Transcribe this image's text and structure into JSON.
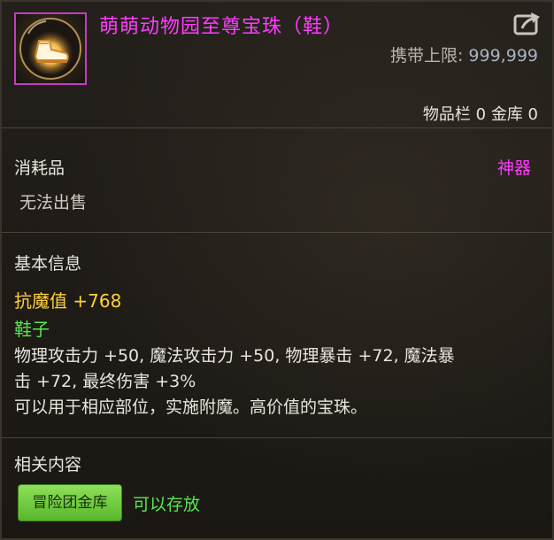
{
  "item": {
    "title": "萌萌动物园至尊宝珠（鞋）",
    "icon": "orb-shoe-icon",
    "carry_limit_label": "携带上限:",
    "carry_limit_value": "999,999",
    "inventory_text": "物品栏 0 金库 0"
  },
  "category": {
    "type": "消耗品",
    "rarity": "神器",
    "sell_note": "无法出售"
  },
  "basic_info": {
    "heading": "基本信息",
    "magic_resist": "抗魔值 +768",
    "slot": "鞋子",
    "desc_line1": "物理攻击力 +50, 魔法攻击力 +50, 物理暴击 +72, 魔法暴",
    "desc_line2": "击 +72, 最终伤害 +3%",
    "desc_line3": "可以用于相应部位，实施附魔。高价值的宝珠。"
  },
  "related": {
    "heading": "相关内容",
    "tag_label": "冒险团金库",
    "tag_status": "可以存放"
  },
  "colors": {
    "title": "#ff3dff",
    "rarity": "#ff3dff",
    "stat": "#ffd23a",
    "green": "#55e84f"
  }
}
